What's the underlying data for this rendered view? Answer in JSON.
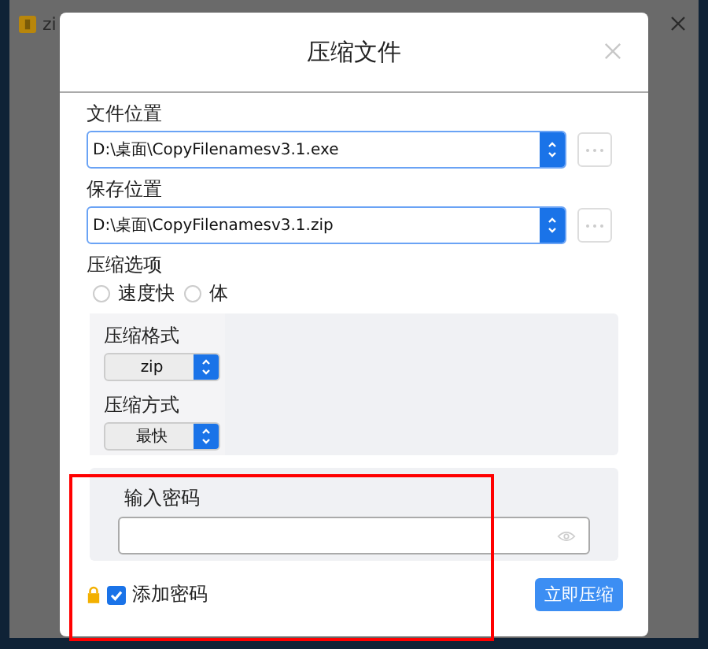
{
  "background_window": {
    "title": "zi"
  },
  "dialog": {
    "title": "压缩文件",
    "fields": [
      {
        "label": "文件位置",
        "value": "D:\\桌面\\CopyFilenamesv3.1.exe"
      },
      {
        "label": "保存位置",
        "value": "D:\\桌面\\CopyFilenamesv3.1.zip"
      }
    ],
    "options_label": "压缩选项",
    "options": [
      {
        "label": "速度快",
        "selected": false
      },
      {
        "label": "体",
        "selected": false
      }
    ],
    "settings": [
      {
        "label": "压缩格式",
        "value": "zip"
      },
      {
        "label": "压缩方式",
        "value": "最快"
      }
    ],
    "password": {
      "label": "输入密码"
    },
    "add_password": {
      "label": "添加密码",
      "checked": true
    },
    "submit": "立即压缩"
  }
}
